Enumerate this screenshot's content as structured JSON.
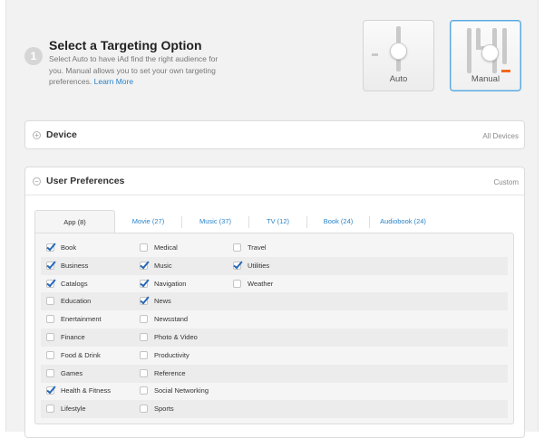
{
  "step": {
    "number": "1",
    "title": "Select a Targeting Option",
    "description": "Select Auto to have iAd find the right audience for you. Manual allows you to set your own targeting preferences.",
    "learn_more": "Learn More"
  },
  "options": {
    "auto_label": "Auto",
    "manual_label": "Manual",
    "selected": "Manual"
  },
  "device_panel": {
    "toggle": "+",
    "title": "Device",
    "value": "All Devices"
  },
  "prefs_panel": {
    "toggle": "−",
    "title": "User Preferences",
    "value": "Custom"
  },
  "tabs": [
    {
      "label": "App (8)",
      "active": true
    },
    {
      "label": "Movie (27)",
      "active": false
    },
    {
      "label": "Music (37)",
      "active": false
    },
    {
      "label": "TV (12)",
      "active": false
    },
    {
      "label": "Book (24)",
      "active": false
    },
    {
      "label": "Audiobook (24)",
      "active": false
    }
  ],
  "categories": {
    "col1": [
      {
        "label": "Book",
        "checked": true
      },
      {
        "label": "Business",
        "checked": true
      },
      {
        "label": "Catalogs",
        "checked": true
      },
      {
        "label": "Education",
        "checked": false
      },
      {
        "label": "Enertainment",
        "checked": false
      },
      {
        "label": "Finance",
        "checked": false
      },
      {
        "label": "Food & Drink",
        "checked": false
      },
      {
        "label": "Games",
        "checked": false
      },
      {
        "label": "Health & Fitness",
        "checked": true
      },
      {
        "label": "Lifestyle",
        "checked": false
      }
    ],
    "col2": [
      {
        "label": "Medical",
        "checked": false
      },
      {
        "label": "Music",
        "checked": true
      },
      {
        "label": "Navigation",
        "checked": true
      },
      {
        "label": "News",
        "checked": true
      },
      {
        "label": "Newsstand",
        "checked": false
      },
      {
        "label": "Photo & Video",
        "checked": false
      },
      {
        "label": "Productivity",
        "checked": false
      },
      {
        "label": "Reference",
        "checked": false
      },
      {
        "label": "Social Networking",
        "checked": false
      },
      {
        "label": "Sports",
        "checked": false
      }
    ],
    "col3": [
      {
        "label": "Travel",
        "checked": false
      },
      {
        "label": "Utilities",
        "checked": true
      },
      {
        "label": "Weather",
        "checked": false
      }
    ]
  },
  "colors": {
    "link": "#2a83c9",
    "selected_border": "#58a9e0",
    "accent_orange": "#f26a1b",
    "checkmark": "#2567b8"
  }
}
